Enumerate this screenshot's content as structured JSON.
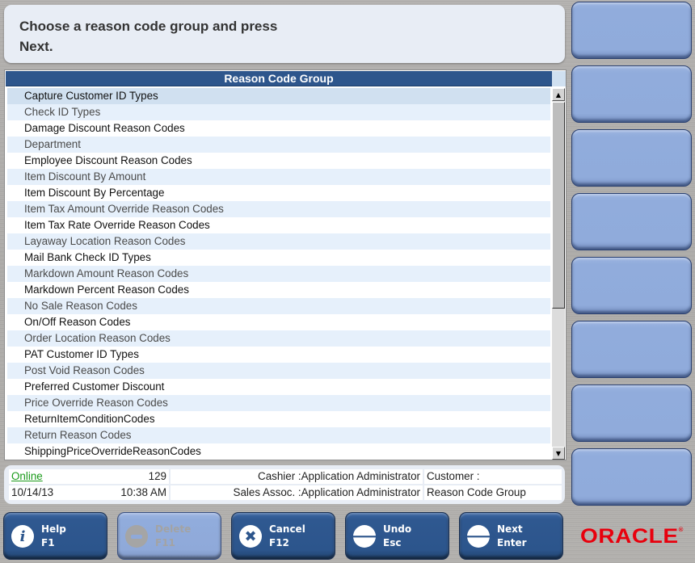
{
  "prompt": {
    "line1": "Choose a reason code group and press",
    "line2": "Next."
  },
  "list": {
    "header": "Reason Code Group",
    "selected_index": 0,
    "items": [
      "Capture Customer ID Types",
      "Check ID Types",
      "Damage Discount Reason Codes",
      "Department",
      "Employee Discount Reason Codes",
      "Item Discount By Amount",
      "Item Discount By Percentage",
      "Item Tax Amount Override Reason Codes",
      "Item Tax Rate Override Reason Codes",
      "Layaway Location Reason Codes",
      "Mail Bank Check ID Types",
      "Markdown Amount Reason Codes",
      "Markdown Percent Reason Codes",
      "No Sale Reason Codes",
      "On/Off Reason Codes",
      "Order Location Reason Codes",
      "PAT Customer ID Types",
      "Post Void Reason Codes",
      "Preferred Customer Discount",
      "Price Override Reason Codes",
      "ReturnItemConditionCodes",
      "Return Reason Codes",
      "ShippingPriceOverrideReasonCodes"
    ]
  },
  "status": {
    "online": "Online",
    "register": "129",
    "cashier": "Cashier :Application Administrator",
    "customer": "Customer :",
    "date": "10/14/13",
    "time": "10:38 AM",
    "sales_assoc": "Sales Assoc. :Application Administrator",
    "screen": "Reason Code Group"
  },
  "buttons": {
    "help": {
      "label": "Help",
      "key": "F1",
      "icon": "info-icon"
    },
    "delete": {
      "label": "Delete",
      "key": "F11",
      "icon": "minus-circle-icon",
      "disabled": true
    },
    "cancel": {
      "label": "Cancel",
      "key": "F12",
      "icon": "x-circle-icon"
    },
    "undo": {
      "label": "Undo",
      "key": "Esc",
      "icon": "arrow-left-icon"
    },
    "next": {
      "label": "Next",
      "key": "Enter",
      "icon": "arrow-right-icon"
    }
  },
  "brand": {
    "logo_text": "ORACLE",
    "mark": "®",
    "color": "#e8000d"
  },
  "colors": {
    "header_bg": "#2e568c",
    "selected_row": "#d0e0f0",
    "alt_row": "#e6f0fb",
    "side_button": "#91acdc",
    "bottom_button": "#2c558c",
    "online": "#1a9a1a"
  }
}
